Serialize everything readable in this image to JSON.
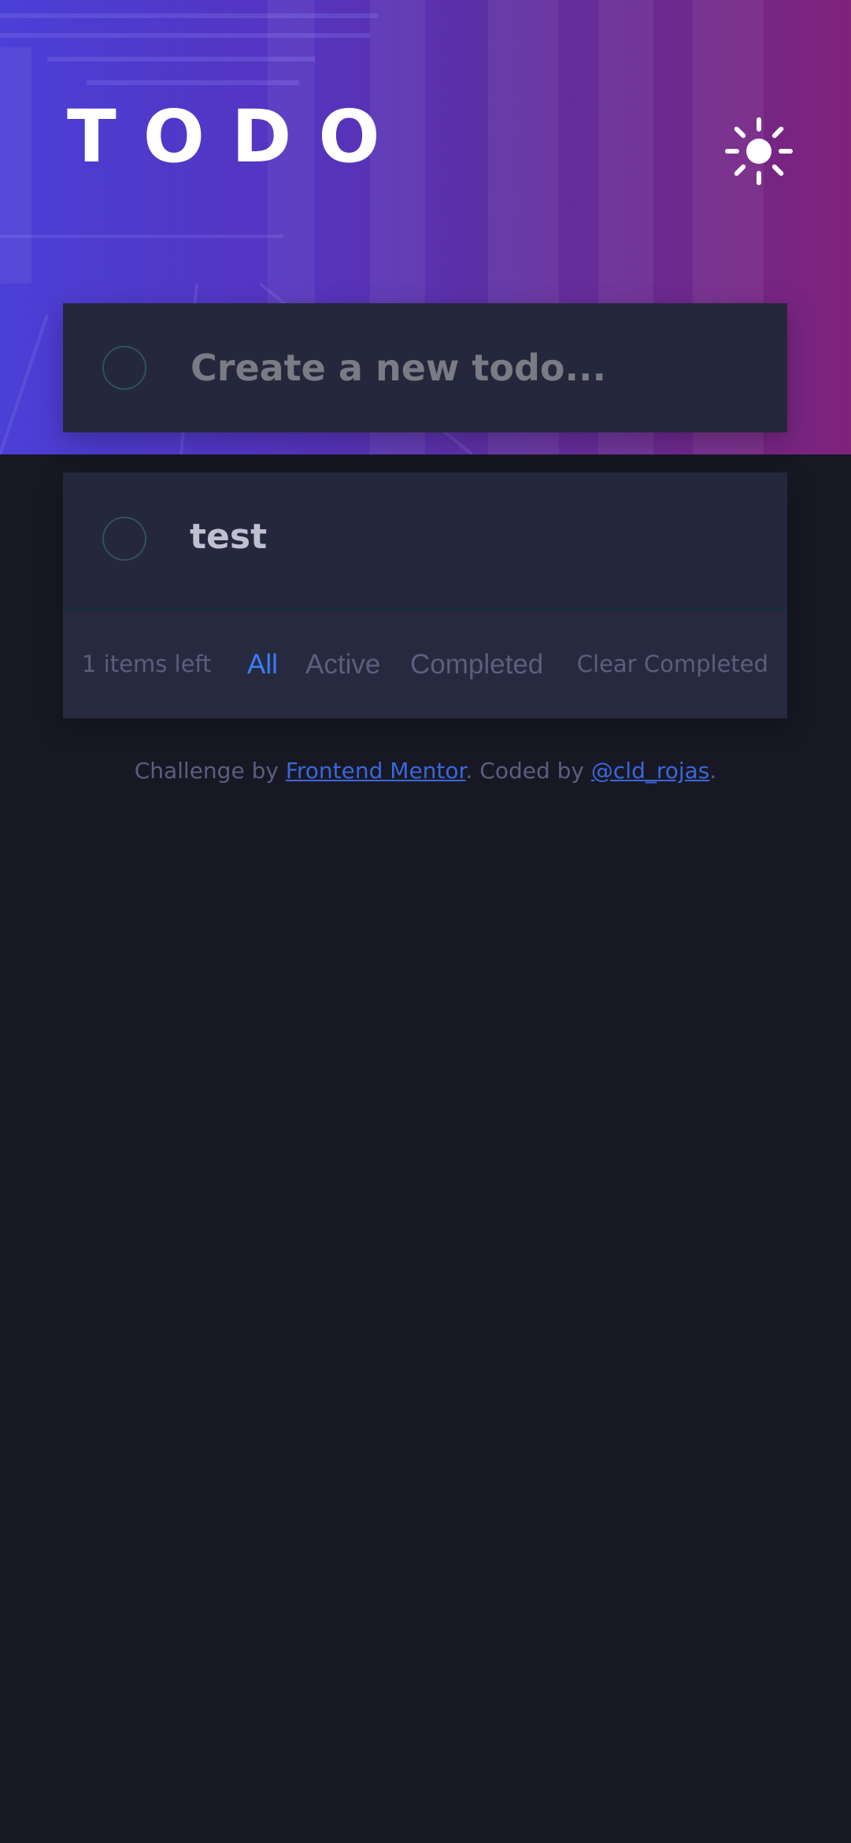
{
  "header": {
    "title": "TODO",
    "theme_toggle_icon": "sun-icon"
  },
  "new_todo": {
    "placeholder": "Create a new todo...",
    "value": ""
  },
  "todos": [
    {
      "text": "test",
      "completed": false
    }
  ],
  "footer": {
    "items_left": "1 items left",
    "filters": [
      {
        "label": "All",
        "selected": true
      },
      {
        "label": "Active",
        "selected": false
      },
      {
        "label": "Completed",
        "selected": false
      }
    ],
    "clear_completed": "Clear Completed"
  },
  "attribution": {
    "prefix": "Challenge by ",
    "frontend_mentor": "Frontend Mentor",
    "middle": ". Coded by ",
    "author": "@cld_rojas",
    "suffix": "."
  },
  "colors": {
    "background": "#181824",
    "card": "#25273c",
    "accent": "#3a7bfd",
    "muted_text": "#5b5e7e"
  }
}
